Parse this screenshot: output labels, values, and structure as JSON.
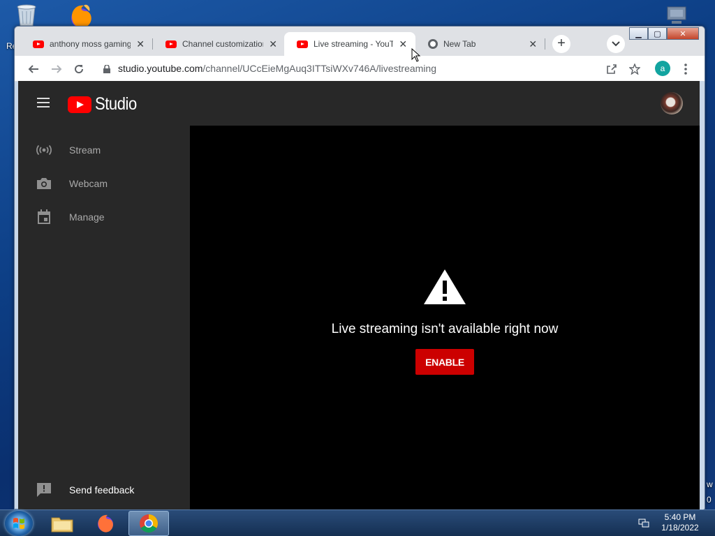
{
  "desktop": {
    "partial_labels": {
      "left": "Re",
      "right_w": "w",
      "right_zero": "0"
    }
  },
  "browser": {
    "tabs": [
      {
        "title": "anthony moss gaming",
        "favicon": "youtube-icon",
        "active": false
      },
      {
        "title": "Channel customization",
        "favicon": "youtube-icon",
        "active": false
      },
      {
        "title": "Live streaming - YouTube",
        "favicon": "youtube-icon",
        "active": true
      },
      {
        "title": "New Tab",
        "favicon": "chrome-icon",
        "active": false
      }
    ],
    "new_tab_label": "+",
    "address": {
      "host": "studio.youtube.com",
      "path": "/channel/UCcEieMgAuq3ITTsiWXv746A/livestreaming"
    },
    "profile_initial": "a"
  },
  "studio": {
    "logo_text": "Studio",
    "nav": [
      {
        "label": "Stream",
        "icon": "broadcast-icon"
      },
      {
        "label": "Webcam",
        "icon": "camera-icon"
      },
      {
        "label": "Manage",
        "icon": "calendar-icon"
      }
    ],
    "feedback_label": "Send feedback",
    "message": "Live streaming isn't available right now",
    "enable_label": "ENABLE"
  },
  "taskbar": {
    "time": "5:40 PM",
    "date": "1/18/2022"
  },
  "colors": {
    "youtube_red": "#ff0000",
    "enable_button": "#cc0000",
    "studio_surface": "#282828",
    "main_background": "#000000"
  }
}
